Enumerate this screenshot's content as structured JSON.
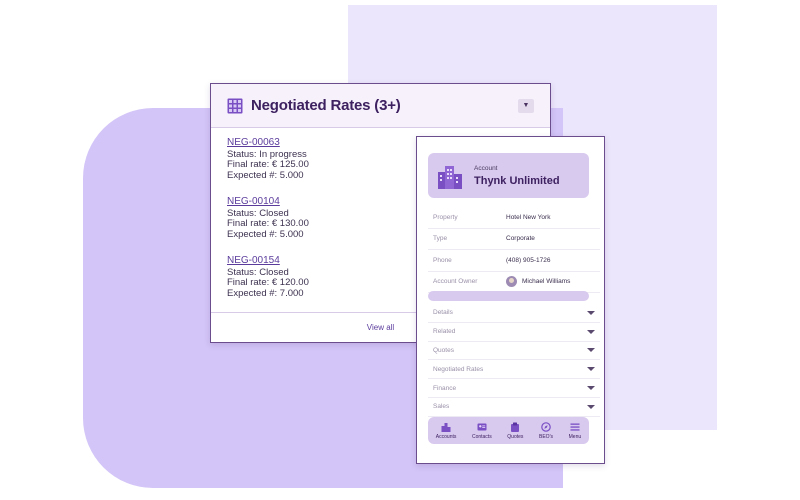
{
  "rates_card": {
    "title": "Negotiated Rates (3+)",
    "items": [
      {
        "id": "NEG-00063",
        "status": "Status: In progress",
        "final_rate": "Final rate: € 125.00",
        "expected": "Expected #: 5.000"
      },
      {
        "id": "NEG-00104",
        "status": "Status: Closed",
        "final_rate": "Final rate: € 130.00",
        "expected": "Expected #: 5.000"
      },
      {
        "id": "NEG-00154",
        "status": "Status: Closed",
        "final_rate": "Final rate: € 120.00",
        "expected": "Expected #: 7.000"
      }
    ],
    "view_all": "View all"
  },
  "account": {
    "label": "Account",
    "name": "Thynk Unlimited",
    "fields": [
      {
        "label": "Property",
        "value": "Hotel New York"
      },
      {
        "label": "Type",
        "value": "Corporate"
      },
      {
        "label": "Phone",
        "value": "(408) 905-1726"
      },
      {
        "label": "Account Owner",
        "value": "Michael Williams"
      }
    ],
    "sections": [
      "Details",
      "Related",
      "Quotes",
      "Negotiated Rates",
      "Finance",
      "Sales"
    ],
    "nav": [
      "Accounts",
      "Contacts",
      "Quotes",
      "BEO's",
      "Menu"
    ]
  },
  "colors": {
    "accent": "#3d2160",
    "panel": "#d8c9ee",
    "background_light": "#ece6fc",
    "background_blob": "#d3c5f7"
  },
  "icons": {
    "rates_header": "calendar-grid-icon",
    "account_header": "buildings-icon",
    "dropdown": "chevron-down-icon",
    "section_caret": "caret-down-icon",
    "nav": [
      "buildings-icon",
      "contact-card-icon",
      "quotes-icon",
      "compass-icon",
      "hamburger-menu-icon"
    ]
  }
}
